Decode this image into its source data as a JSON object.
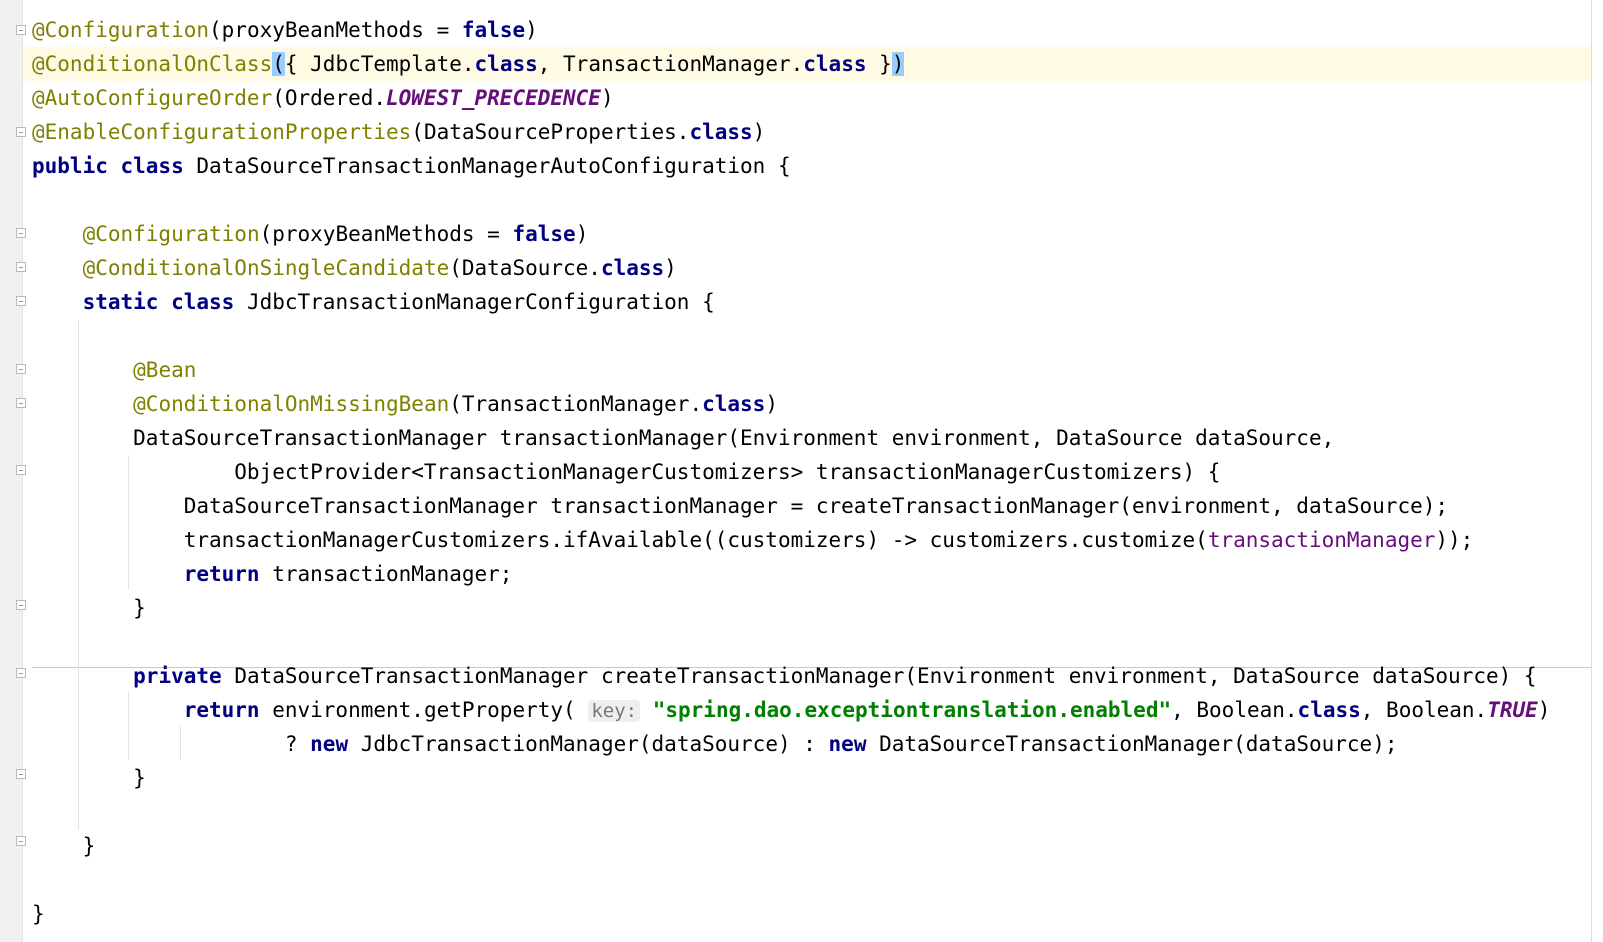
{
  "editor": {
    "language": "Java",
    "colors": {
      "background": "#ffffff",
      "annotation": "#808000",
      "keyword": "#000080",
      "constant": "#660e7a",
      "string": "#008000",
      "caret_line": "#fffae3",
      "brace_match": "#99ccff",
      "gutter": "#f0f0f0"
    },
    "lines": [
      {
        "t": [
          {
            "c": "ann",
            "v": "@Configuration"
          },
          {
            "c": "",
            "v": "(proxyBeanMethods = "
          },
          {
            "c": "kw",
            "v": "false"
          },
          {
            "c": "",
            "v": ")"
          }
        ]
      },
      {
        "t": [
          {
            "c": "ann",
            "v": "@ConditionalOnClass"
          },
          {
            "c": "brace-hl",
            "v": "("
          },
          {
            "c": "",
            "v": "{ JdbcTemplate."
          },
          {
            "c": "kw",
            "v": "class"
          },
          {
            "c": "",
            "v": ", TransactionManager."
          },
          {
            "c": "kw",
            "v": "class"
          },
          {
            "c": "",
            "v": " }"
          },
          {
            "c": "brace-hl",
            "v": ")"
          }
        ]
      },
      {
        "t": [
          {
            "c": "ann",
            "v": "@AutoConfigureOrder"
          },
          {
            "c": "",
            "v": "(Ordered."
          },
          {
            "c": "konst",
            "v": "LOWEST_PRECEDENCE"
          },
          {
            "c": "",
            "v": ")"
          }
        ]
      },
      {
        "t": [
          {
            "c": "ann",
            "v": "@EnableConfigurationProperties"
          },
          {
            "c": "",
            "v": "(DataSourceProperties."
          },
          {
            "c": "kw",
            "v": "class"
          },
          {
            "c": "",
            "v": ")"
          }
        ]
      },
      {
        "t": [
          {
            "c": "kw",
            "v": "public class"
          },
          {
            "c": "",
            "v": " DataSourceTransactionManagerAutoConfiguration {"
          }
        ]
      },
      {
        "t": []
      },
      {
        "t": [
          {
            "c": "",
            "v": "    "
          },
          {
            "c": "ann",
            "v": "@Configuration"
          },
          {
            "c": "",
            "v": "(proxyBeanMethods = "
          },
          {
            "c": "kw",
            "v": "false"
          },
          {
            "c": "",
            "v": ")"
          }
        ]
      },
      {
        "t": [
          {
            "c": "",
            "v": "    "
          },
          {
            "c": "ann",
            "v": "@ConditionalOnSingleCandidate"
          },
          {
            "c": "",
            "v": "(DataSource."
          },
          {
            "c": "kw",
            "v": "class"
          },
          {
            "c": "",
            "v": ")"
          }
        ]
      },
      {
        "t": [
          {
            "c": "",
            "v": "    "
          },
          {
            "c": "kw",
            "v": "static class"
          },
          {
            "c": "",
            "v": " JdbcTransactionManagerConfiguration {"
          }
        ]
      },
      {
        "t": []
      },
      {
        "t": [
          {
            "c": "",
            "v": "        "
          },
          {
            "c": "ann",
            "v": "@Bean"
          }
        ]
      },
      {
        "t": [
          {
            "c": "",
            "v": "        "
          },
          {
            "c": "ann",
            "v": "@ConditionalOnMissingBean"
          },
          {
            "c": "",
            "v": "(TransactionManager."
          },
          {
            "c": "kw",
            "v": "class"
          },
          {
            "c": "",
            "v": ")"
          }
        ]
      },
      {
        "t": [
          {
            "c": "",
            "v": "        DataSourceTransactionManager transactionManager(Environment environment, DataSource dataSource,"
          }
        ]
      },
      {
        "t": [
          {
            "c": "",
            "v": "                ObjectProvider<TransactionManagerCustomizers> transactionManagerCustomizers) {"
          }
        ]
      },
      {
        "t": [
          {
            "c": "",
            "v": "            DataSourceTransactionManager transactionManager = createTransactionManager(environment, dataSource);"
          }
        ]
      },
      {
        "t": [
          {
            "c": "",
            "v": "            transactionManagerCustomizers.ifAvailable((customizers) -> customizers.customize("
          },
          {
            "c": "field",
            "v": "transactionManager"
          },
          {
            "c": "",
            "v": "));"
          }
        ]
      },
      {
        "t": [
          {
            "c": "",
            "v": "            "
          },
          {
            "c": "kw",
            "v": "return"
          },
          {
            "c": "",
            "v": " transactionManager;"
          }
        ]
      },
      {
        "t": [
          {
            "c": "",
            "v": "        }"
          }
        ]
      },
      {
        "t": []
      },
      {
        "t": [
          {
            "c": "",
            "v": "        "
          },
          {
            "c": "kw",
            "v": "private"
          },
          {
            "c": "",
            "v": " DataSourceTransactionManager createTransactionManager(Environment environment, DataSource dataSource) {"
          }
        ]
      },
      {
        "t": [
          {
            "c": "",
            "v": "            "
          },
          {
            "c": "kw",
            "v": "return"
          },
          {
            "c": "",
            "v": " environment.getProperty( "
          },
          {
            "c": "hint",
            "v": "key:"
          },
          {
            "c": "",
            "v": " "
          },
          {
            "c": "str",
            "v": "\"spring.dao.exceptiontranslation.enabled\""
          },
          {
            "c": "",
            "v": ", Boolean."
          },
          {
            "c": "kw",
            "v": "class"
          },
          {
            "c": "",
            "v": ", Boolean."
          },
          {
            "c": "konst",
            "v": "TRUE"
          },
          {
            "c": "",
            "v": ")"
          }
        ]
      },
      {
        "t": [
          {
            "c": "",
            "v": "                    ? "
          },
          {
            "c": "kw",
            "v": "new"
          },
          {
            "c": "",
            "v": " JdbcTransactionManager(dataSource) : "
          },
          {
            "c": "kw",
            "v": "new"
          },
          {
            "c": "",
            "v": " DataSourceTransactionManager(dataSource);"
          }
        ]
      },
      {
        "t": [
          {
            "c": "",
            "v": "        }"
          }
        ]
      },
      {
        "t": []
      },
      {
        "t": [
          {
            "c": "",
            "v": "    }"
          }
        ]
      },
      {
        "t": []
      },
      {
        "t": [
          {
            "c": "",
            "v": "}"
          }
        ]
      }
    ]
  }
}
